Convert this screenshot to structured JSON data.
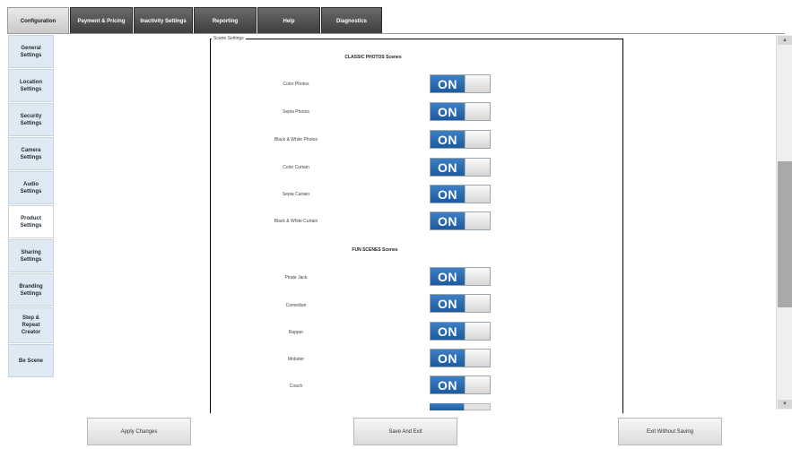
{
  "tabs": [
    {
      "label": "Configuration",
      "active": true
    },
    {
      "label": "Payment & Pricing",
      "active": false
    },
    {
      "label": "Inactivity Settings",
      "active": false
    },
    {
      "label": "Reporting",
      "active": false
    },
    {
      "label": "Help",
      "active": false
    },
    {
      "label": "Diagnostics",
      "active": false
    }
  ],
  "sidebar": {
    "items": [
      {
        "label": "General\nSettings",
        "active": false
      },
      {
        "label": "Location\nSettings",
        "active": false
      },
      {
        "label": "Security\nSettings",
        "active": false
      },
      {
        "label": "Camera\nSettings",
        "active": false
      },
      {
        "label": "Audio\nSettings",
        "active": false
      },
      {
        "label": "Product\nSettings",
        "active": true
      },
      {
        "label": "Sharing\nSettings",
        "active": false
      },
      {
        "label": "Branding\nSettings",
        "active": false
      },
      {
        "label": "Step &\nRepeat\nCreator",
        "active": false
      },
      {
        "label": "Be Scene",
        "active": false
      }
    ]
  },
  "panel": {
    "legend": "Scene Settings",
    "sections": [
      {
        "title": "CLASSIC PHOTOS Scenes"
      },
      {
        "title": "FUN SCENES Scenes"
      }
    ],
    "rows": [
      {
        "label": "Color Photos",
        "state": "ON"
      },
      {
        "label": "Sepia Photos",
        "state": "ON"
      },
      {
        "label": "Black & White Photos",
        "state": "ON"
      },
      {
        "label": "Color Curtain",
        "state": "ON"
      },
      {
        "label": "Sepia Curtain",
        "state": "ON"
      },
      {
        "label": "Black & White Curtain",
        "state": "ON"
      },
      {
        "label": "Pirate Jack",
        "state": "ON"
      },
      {
        "label": "Comedian",
        "state": "ON"
      },
      {
        "label": "Rapper",
        "state": "ON"
      },
      {
        "label": "Mobster",
        "state": "ON"
      },
      {
        "label": "Coach",
        "state": "ON"
      }
    ]
  },
  "scrollbar": {
    "up_arrow": "▲",
    "down_arrow": "▼"
  },
  "buttons": {
    "apply": "Apply Changes",
    "save_exit": "Save And Exit",
    "exit_no_save": "Exit Without Saving"
  },
  "colors": {
    "toggle_on": "#2a6bb3",
    "tab_dark": "#4a4a4a",
    "sidebar_bg": "#dfe9f3"
  }
}
